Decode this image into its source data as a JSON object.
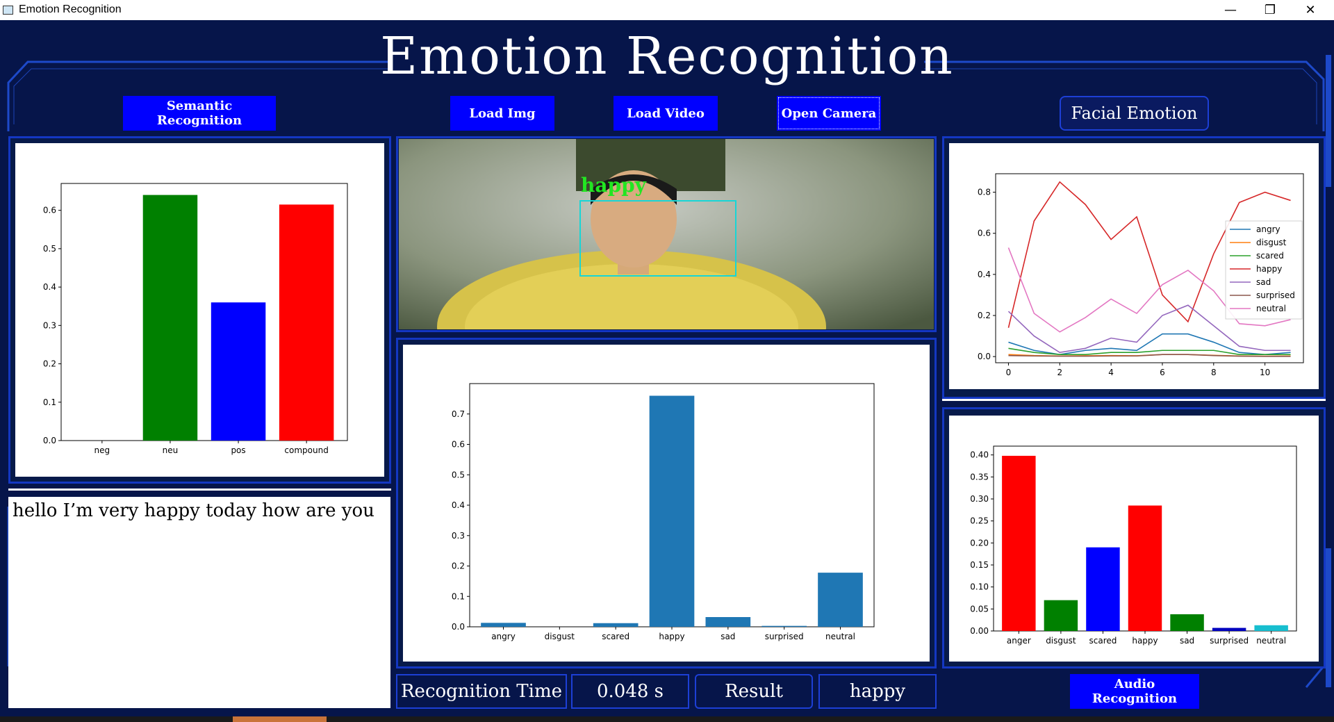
{
  "window": {
    "title": "Emotion Recognition",
    "controls": [
      "—",
      "❐",
      "✕"
    ]
  },
  "header": {
    "title": "Emotion Recognition"
  },
  "buttons": {
    "semantic": "Semantic Recognition",
    "load_img": "Load Img",
    "load_video": "Load Video",
    "open_camera": "Open Camera",
    "facial_emotion": "Facial Emotion",
    "audio": "Audio Recognition"
  },
  "text_input": {
    "value": "hello I’m very happy today how are you"
  },
  "camera": {
    "face_label": "happy"
  },
  "status": {
    "time_label": "Recognition Time",
    "time_value": "0.048 s",
    "result_label": "Result",
    "result_value": "happy"
  },
  "colors": {
    "accent_blue": "#0000ff",
    "frame": "#1d49c9",
    "bg": "#06154a",
    "bar_default": "#1f77b4"
  },
  "chart_data": [
    {
      "id": "semantic",
      "type": "bar",
      "categories": [
        "neg",
        "neu",
        "pos",
        "compound"
      ],
      "values": [
        0.0,
        0.64,
        0.36,
        0.615
      ],
      "colors": [
        "#ffffff",
        "#008000",
        "#0000ff",
        "#ff0000"
      ],
      "ylim": [
        0,
        0.67
      ],
      "yticks": [
        "0.0",
        "0.1",
        "0.2",
        "0.3",
        "0.4",
        "0.5",
        "0.6"
      ]
    },
    {
      "id": "facial-bar",
      "type": "bar",
      "categories": [
        "angry",
        "disgust",
        "scared",
        "happy",
        "sad",
        "surprised",
        "neutral"
      ],
      "values": [
        0.013,
        0.0,
        0.012,
        0.76,
        0.032,
        0.003,
        0.178
      ],
      "ylim": [
        0,
        0.8
      ],
      "yticks": [
        "0.0",
        "0.1",
        "0.2",
        "0.3",
        "0.4",
        "0.5",
        "0.6",
        "0.7"
      ]
    },
    {
      "id": "facial-line",
      "type": "line",
      "x": [
        0,
        1,
        2,
        3,
        4,
        5,
        6,
        7,
        8,
        9,
        10,
        11
      ],
      "xlim": [
        -0.5,
        11.5
      ],
      "ylim": [
        -0.03,
        0.89
      ],
      "xticks": [
        "0",
        "2",
        "4",
        "6",
        "8",
        "10"
      ],
      "yticks": [
        "0.0",
        "0.2",
        "0.4",
        "0.6",
        "0.8"
      ],
      "legend_position": "right",
      "series": [
        {
          "name": "angry",
          "color": "#1f77b4",
          "values": [
            0.07,
            0.03,
            0.01,
            0.03,
            0.04,
            0.03,
            0.11,
            0.11,
            0.07,
            0.02,
            0.01,
            0.02
          ]
        },
        {
          "name": "disgust",
          "color": "#ff7f0e",
          "values": [
            0.01,
            0.005,
            0.003,
            0.004,
            0.005,
            0.004,
            0.01,
            0.01,
            0.006,
            0.003,
            0.002,
            0.003
          ]
        },
        {
          "name": "scared",
          "color": "#2ca02c",
          "values": [
            0.04,
            0.02,
            0.01,
            0.01,
            0.02,
            0.02,
            0.03,
            0.03,
            0.03,
            0.01,
            0.01,
            0.01
          ]
        },
        {
          "name": "happy",
          "color": "#d62728",
          "values": [
            0.14,
            0.66,
            0.85,
            0.74,
            0.57,
            0.68,
            0.3,
            0.17,
            0.5,
            0.75,
            0.8,
            0.76
          ]
        },
        {
          "name": "sad",
          "color": "#9467bd",
          "values": [
            0.22,
            0.1,
            0.02,
            0.04,
            0.09,
            0.07,
            0.2,
            0.25,
            0.15,
            0.05,
            0.03,
            0.03
          ]
        },
        {
          "name": "surprised",
          "color": "#8c564b",
          "values": [
            0.005,
            0.003,
            0.002,
            0.002,
            0.003,
            0.003,
            0.01,
            0.01,
            0.005,
            0.002,
            0.001,
            0.001
          ]
        },
        {
          "name": "neutral",
          "color": "#e377c2",
          "values": [
            0.53,
            0.21,
            0.12,
            0.19,
            0.28,
            0.21,
            0.35,
            0.42,
            0.32,
            0.16,
            0.15,
            0.18
          ]
        }
      ]
    },
    {
      "id": "audio",
      "type": "bar",
      "categories": [
        "anger",
        "disgust",
        "scared",
        "happy",
        "sad",
        "surprised",
        "neutral"
      ],
      "values": [
        0.398,
        0.07,
        0.19,
        0.285,
        0.038,
        0.007,
        0.013
      ],
      "colors": [
        "#ff0000",
        "#008000",
        "#0000ff",
        "#ff0000",
        "#008000",
        "#0000bf",
        "#17becf"
      ],
      "ylim": [
        0,
        0.42
      ],
      "yticks": [
        "0.00",
        "0.05",
        "0.10",
        "0.15",
        "0.20",
        "0.25",
        "0.30",
        "0.35",
        "0.40"
      ]
    }
  ]
}
